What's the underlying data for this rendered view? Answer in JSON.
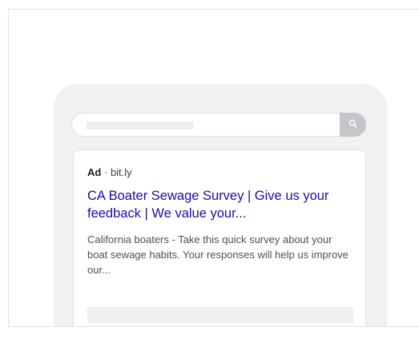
{
  "ad": {
    "label": "Ad",
    "separator": "·",
    "domain": "bit.ly",
    "title": "CA Boater Sewage Survey | Give us your feedback | We value your...",
    "description": "California boaters - Take this quick survey about your boat sewage habits. Your responses will help us improve our..."
  },
  "icons": {
    "search": "search-icon"
  },
  "colors": {
    "title_link": "#1a0dab",
    "description": "#4d5156",
    "search_button": "#c4c6cb",
    "phone_frame": "#f1f1f1"
  }
}
